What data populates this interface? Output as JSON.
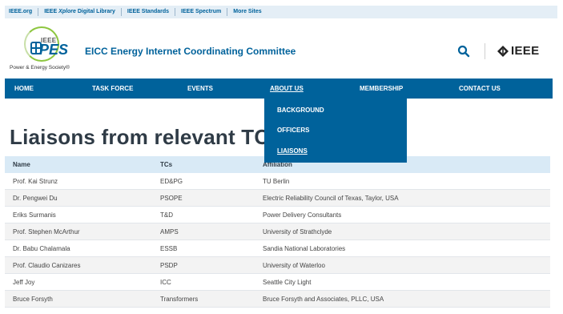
{
  "topbar": {
    "links": [
      {
        "label": "IEEE.org"
      },
      {
        "prefix": "IEEE ",
        "em": "Xplore",
        "suffix": " Digital Library"
      },
      {
        "label": "IEEE Standards"
      },
      {
        "label": "IEEE Spectrum"
      },
      {
        "label": "More Sites"
      }
    ]
  },
  "logo": {
    "ieee": "IEEE",
    "pes": "PES",
    "tagline": "Power & Energy Society®"
  },
  "header": {
    "title": "EICC Energy Internet Coordinating Committee",
    "ieee_brand": "IEEE",
    "search_icon": "search-icon",
    "brand_icon": "ieee-diamond-icon"
  },
  "nav": {
    "items": [
      {
        "label": "HOME"
      },
      {
        "label": "TASK FORCE"
      },
      {
        "label": "EVENTS"
      },
      {
        "label": "ABOUT US"
      },
      {
        "label": "MEMBERSHIP"
      },
      {
        "label": "CONTACT US"
      }
    ],
    "active": "ABOUT US"
  },
  "dropdown": {
    "items": [
      {
        "label": "BACKGROUND"
      },
      {
        "label": "OFFICERS"
      },
      {
        "label": "LIAISONS"
      }
    ],
    "current": "LIAISONS"
  },
  "page": {
    "heading": "Liaisons from relevant TCs"
  },
  "table": {
    "columns": [
      "Name",
      "TCs",
      "Affiliation"
    ],
    "rows": [
      [
        "Prof. Kai Strunz",
        "ED&PG",
        "TU Berlin"
      ],
      [
        "Dr. Pengwei Du",
        "PSOPE",
        "Electric Reliability Council of Texas, Taylor, USA"
      ],
      [
        "Eriks Surmanis",
        "T&D",
        "Power Delivery Consultants"
      ],
      [
        "Prof. Stephen McArthur",
        "AMPS",
        "University of Strathclyde"
      ],
      [
        "Dr. Babu Chalamala",
        "ESSB",
        "Sandia National Laboratories"
      ],
      [
        "Prof. Claudio Canizares",
        "PSDP",
        "University of Waterloo"
      ],
      [
        "Jeff Joy",
        "ICC",
        "Seattle City Light"
      ],
      [
        "Bruce Forsyth",
        "Transformers",
        "Bruce Forsyth and Associates, PLLC, USA"
      ]
    ]
  },
  "colors": {
    "brand_blue": "#00629b",
    "topbar_bg": "#e4eef6",
    "table_header_bg": "#d9eaf6",
    "logo_green": "#8dc63f"
  }
}
